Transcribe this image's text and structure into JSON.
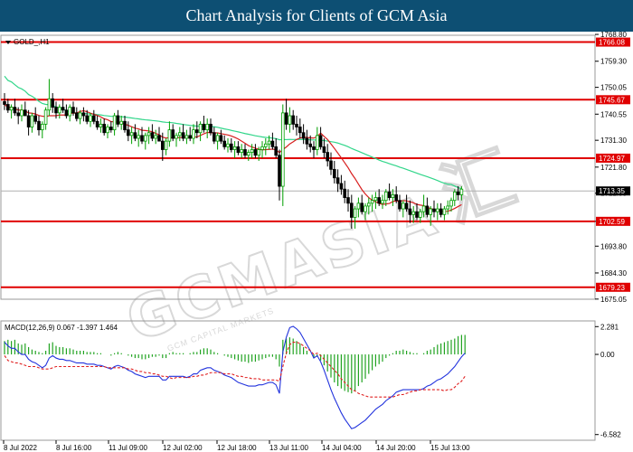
{
  "header": {
    "title": "Chart Analysis for Clients of GCM Asia"
  },
  "watermark": {
    "text": "GCMASIA",
    "chinese": "汇",
    "sub": "GCM CAPITAL MARKETS"
  },
  "chart_data": {
    "type": "candlestick",
    "symbol": "GOLD_,H1",
    "ylim": [
      1675.0,
      1768.5
    ],
    "y_ticks": [
      1768.8,
      1759.3,
      1750.05,
      1740.55,
      1731.3,
      1721.8,
      1712.55,
      1702.59,
      1693.8,
      1684.3,
      1675.05
    ],
    "x_ticks": [
      "8 Jul 2022",
      "8 Jul 16:00",
      "11 Jul 09:00",
      "12 Jul 02:00",
      "12 Jul 18:00",
      "13 Jul 11:00",
      "14 Jul 04:00",
      "14 Jul 20:00",
      "15 Jul 13:00"
    ],
    "levels": [
      {
        "value": 1766.08,
        "label": "1766.08"
      },
      {
        "value": 1745.67,
        "label": "1745.67"
      },
      {
        "value": 1724.97,
        "label": "1724.97"
      },
      {
        "value": 1702.59,
        "label": "1702.59"
      },
      {
        "value": 1679.23,
        "label": "1679.23"
      }
    ],
    "current_price": {
      "value": 1713.35,
      "label": "1713.35"
    },
    "candles": [
      [
        1745,
        1748,
        1742,
        1744
      ],
      [
        1744,
        1746,
        1741,
        1742
      ],
      [
        1742,
        1744,
        1739,
        1743
      ],
      [
        1743,
        1746,
        1740,
        1741
      ],
      [
        1741,
        1743,
        1737,
        1740
      ],
      [
        1740,
        1744,
        1738,
        1742
      ],
      [
        1742,
        1745,
        1740,
        1740
      ],
      [
        1740,
        1742,
        1733,
        1736
      ],
      [
        1736,
        1741,
        1734,
        1740
      ],
      [
        1740,
        1743,
        1737,
        1738
      ],
      [
        1738,
        1740,
        1733,
        1735
      ],
      [
        1735,
        1738,
        1732,
        1737
      ],
      [
        1737,
        1743,
        1735,
        1742
      ],
      [
        1742,
        1753,
        1740,
        1746
      ],
      [
        1746,
        1748,
        1741,
        1743
      ],
      [
        1743,
        1745,
        1739,
        1741
      ],
      [
        1741,
        1744,
        1739,
        1743
      ],
      [
        1743,
        1746,
        1741,
        1742
      ],
      [
        1742,
        1744,
        1739,
        1740
      ],
      [
        1740,
        1744,
        1738,
        1743
      ],
      [
        1743,
        1745,
        1740,
        1741
      ],
      [
        1741,
        1743,
        1738,
        1739
      ],
      [
        1739,
        1742,
        1737,
        1741
      ],
      [
        1741,
        1743,
        1738,
        1740
      ],
      [
        1740,
        1742,
        1737,
        1738
      ],
      [
        1738,
        1741,
        1736,
        1740
      ],
      [
        1740,
        1742,
        1737,
        1738
      ],
      [
        1738,
        1740,
        1735,
        1736
      ],
      [
        1736,
        1739,
        1734,
        1737
      ],
      [
        1737,
        1739,
        1733,
        1734
      ],
      [
        1734,
        1737,
        1732,
        1736
      ],
      [
        1736,
        1738,
        1734,
        1735
      ],
      [
        1735,
        1741,
        1733,
        1740
      ],
      [
        1740,
        1742,
        1736,
        1737
      ],
      [
        1737,
        1740,
        1735,
        1738
      ],
      [
        1738,
        1740,
        1734,
        1735
      ],
      [
        1735,
        1738,
        1731,
        1733
      ],
      [
        1733,
        1736,
        1730,
        1734
      ],
      [
        1734,
        1737,
        1731,
        1732
      ],
      [
        1732,
        1735,
        1729,
        1733
      ],
      [
        1733,
        1736,
        1730,
        1731
      ],
      [
        1731,
        1734,
        1728,
        1733
      ],
      [
        1733,
        1736,
        1730,
        1734
      ],
      [
        1734,
        1737,
        1731,
        1732
      ],
      [
        1732,
        1735,
        1730,
        1733
      ],
      [
        1733,
        1736,
        1731,
        1731
      ],
      [
        1731,
        1734,
        1724,
        1728
      ],
      [
        1728,
        1732,
        1726,
        1731
      ],
      [
        1731,
        1738,
        1729,
        1735
      ],
      [
        1735,
        1737,
        1731,
        1732
      ],
      [
        1732,
        1734,
        1729,
        1733
      ],
      [
        1733,
        1736,
        1731,
        1734
      ],
      [
        1734,
        1737,
        1731,
        1732
      ],
      [
        1732,
        1735,
        1730,
        1733
      ],
      [
        1733,
        1736,
        1731,
        1732
      ],
      [
        1732,
        1737,
        1730,
        1735
      ],
      [
        1735,
        1738,
        1732,
        1734
      ],
      [
        1734,
        1738,
        1731,
        1737
      ],
      [
        1737,
        1740,
        1734,
        1735
      ],
      [
        1735,
        1739,
        1732,
        1737
      ],
      [
        1737,
        1739,
        1733,
        1734
      ],
      [
        1734,
        1736,
        1730,
        1731
      ],
      [
        1731,
        1734,
        1728,
        1733
      ],
      [
        1733,
        1735,
        1730,
        1731
      ],
      [
        1731,
        1733,
        1728,
        1729
      ],
      [
        1729,
        1732,
        1727,
        1730
      ],
      [
        1730,
        1732,
        1727,
        1728
      ],
      [
        1728,
        1731,
        1725,
        1729
      ],
      [
        1729,
        1731,
        1726,
        1727
      ],
      [
        1727,
        1730,
        1725,
        1728
      ],
      [
        1728,
        1730,
        1725,
        1726
      ],
      [
        1726,
        1728,
        1724,
        1727
      ],
      [
        1727,
        1730,
        1725,
        1728
      ],
      [
        1728,
        1730,
        1725,
        1726
      ],
      [
        1726,
        1729,
        1724,
        1728
      ],
      [
        1728,
        1731,
        1725,
        1729
      ],
      [
        1729,
        1732,
        1726,
        1730
      ],
      [
        1730,
        1733,
        1728,
        1731
      ],
      [
        1731,
        1734,
        1728,
        1729
      ],
      [
        1729,
        1732,
        1725,
        1726
      ],
      [
        1726,
        1728,
        1710,
        1715
      ],
      [
        1715,
        1744,
        1708,
        1741
      ],
      [
        1741,
        1746,
        1735,
        1737
      ],
      [
        1737,
        1743,
        1734,
        1740
      ],
      [
        1740,
        1742,
        1735,
        1737
      ],
      [
        1737,
        1740,
        1733,
        1736
      ],
      [
        1736,
        1739,
        1732,
        1734
      ],
      [
        1734,
        1737,
        1730,
        1732
      ],
      [
        1732,
        1735,
        1728,
        1730
      ],
      [
        1730,
        1733,
        1727,
        1729
      ],
      [
        1729,
        1731,
        1725,
        1728
      ],
      [
        1728,
        1736,
        1726,
        1733
      ],
      [
        1733,
        1736,
        1728,
        1729
      ],
      [
        1729,
        1732,
        1725,
        1727
      ],
      [
        1727,
        1730,
        1722,
        1724
      ],
      [
        1724,
        1727,
        1719,
        1721
      ],
      [
        1721,
        1724,
        1716,
        1718
      ],
      [
        1718,
        1721,
        1713,
        1716
      ],
      [
        1716,
        1719,
        1712,
        1714
      ],
      [
        1714,
        1717,
        1709,
        1711
      ],
      [
        1711,
        1714,
        1706,
        1709
      ],
      [
        1709,
        1712,
        1700,
        1704
      ],
      [
        1704,
        1708,
        1700,
        1707
      ],
      [
        1707,
        1711,
        1704,
        1709
      ],
      [
        1709,
        1712,
        1705,
        1706
      ],
      [
        1706,
        1709,
        1703,
        1708
      ],
      [
        1708,
        1711,
        1705,
        1709
      ],
      [
        1709,
        1712,
        1706,
        1710
      ],
      [
        1710,
        1713,
        1707,
        1711
      ],
      [
        1711,
        1714,
        1708,
        1709
      ],
      [
        1709,
        1712,
        1707,
        1710
      ],
      [
        1710,
        1714,
        1708,
        1713
      ],
      [
        1713,
        1716,
        1710,
        1711
      ],
      [
        1711,
        1714,
        1708,
        1712
      ],
      [
        1712,
        1715,
        1709,
        1710
      ],
      [
        1710,
        1712,
        1706,
        1707
      ],
      [
        1707,
        1710,
        1704,
        1709
      ],
      [
        1709,
        1712,
        1706,
        1707
      ],
      [
        1707,
        1710,
        1702,
        1705
      ],
      [
        1705,
        1708,
        1702,
        1706
      ],
      [
        1706,
        1709,
        1703,
        1704
      ],
      [
        1704,
        1707,
        1702,
        1706
      ],
      [
        1706,
        1712,
        1704,
        1708
      ],
      [
        1708,
        1711,
        1704,
        1705
      ],
      [
        1705,
        1708,
        1701,
        1707
      ],
      [
        1707,
        1710,
        1704,
        1706
      ],
      [
        1706,
        1709,
        1703,
        1707
      ],
      [
        1707,
        1709,
        1704,
        1705
      ],
      [
        1705,
        1708,
        1703,
        1707
      ],
      [
        1707,
        1710,
        1705,
        1708
      ],
      [
        1708,
        1711,
        1706,
        1710
      ],
      [
        1710,
        1714,
        1708,
        1713
      ],
      [
        1713,
        1715,
        1710,
        1712
      ],
      [
        1712,
        1715,
        1710,
        1714
      ]
    ],
    "macd": {
      "label": "MACD(12,26,9) 0.067 -1.397 1.464",
      "ylim": [
        -6.9,
        2.6
      ],
      "y_ticks": [
        2.281,
        0.0,
        -6.582
      ],
      "hist": [
        1.1,
        1.2,
        1.1,
        1.2,
        0.9,
        0.8,
        0.9,
        0.6,
        0.4,
        0.3,
        0.2,
        0.1,
        0.3,
        0.9,
        1.0,
        0.7,
        0.6,
        0.6,
        0.5,
        0.5,
        0.4,
        0.3,
        0.3,
        0.3,
        0.2,
        0.2,
        0.2,
        0.1,
        0.1,
        0.0,
        0.0,
        -0.1,
        0.1,
        0.2,
        0.1,
        0.0,
        -0.1,
        -0.2,
        -0.3,
        -0.3,
        -0.4,
        -0.4,
        -0.3,
        -0.2,
        -0.2,
        -0.1,
        -0.3,
        -0.3,
        0.1,
        0.2,
        0.1,
        0.1,
        0.1,
        0.0,
        0.1,
        0.2,
        0.2,
        0.4,
        0.5,
        0.5,
        0.4,
        0.2,
        0.1,
        0.0,
        -0.1,
        -0.2,
        -0.3,
        -0.4,
        -0.5,
        -0.6,
        -0.6,
        -0.7,
        -0.6,
        -0.6,
        -0.5,
        -0.4,
        -0.3,
        -0.2,
        -0.2,
        -0.4,
        -1.0,
        1.2,
        1.3,
        1.4,
        1.3,
        1.1,
        0.9,
        0.6,
        0.3,
        0.0,
        -0.3,
        -0.2,
        -0.5,
        -0.9,
        -1.4,
        -1.9,
        -2.3,
        -2.6,
        -2.8,
        -3.0,
        -3.1,
        -3.2,
        -3.0,
        -2.6,
        -2.3,
        -2.0,
        -1.6,
        -1.3,
        -1.0,
        -0.8,
        -0.6,
        -0.3,
        -0.1,
        0.1,
        0.3,
        0.3,
        0.4,
        0.3,
        0.2,
        0.1,
        0.1,
        0.0,
        0.1,
        0.3,
        0.4,
        0.6,
        0.8,
        0.9,
        1.0,
        1.1,
        1.2,
        1.3,
        1.5,
        1.6,
        1.6
      ],
      "macd": [
        1.0,
        0.7,
        0.5,
        0.5,
        0.2,
        0.0,
        0.0,
        -0.4,
        -0.6,
        -0.7,
        -0.9,
        -1.1,
        -0.9,
        -0.3,
        -0.1,
        -0.3,
        -0.4,
        -0.4,
        -0.5,
        -0.5,
        -0.6,
        -0.7,
        -0.7,
        -0.7,
        -0.8,
        -0.8,
        -0.8,
        -0.9,
        -0.9,
        -1.0,
        -1.1,
        -1.2,
        -1.0,
        -0.9,
        -1.0,
        -1.1,
        -1.3,
        -1.4,
        -1.6,
        -1.7,
        -1.8,
        -1.9,
        -1.8,
        -1.8,
        -1.8,
        -1.8,
        -2.1,
        -2.1,
        -1.8,
        -1.8,
        -1.8,
        -1.8,
        -1.8,
        -1.9,
        -1.8,
        -1.6,
        -1.6,
        -1.3,
        -1.2,
        -1.1,
        -1.1,
        -1.3,
        -1.4,
        -1.5,
        -1.7,
        -1.8,
        -1.9,
        -2.1,
        -2.3,
        -2.4,
        -2.5,
        -2.6,
        -2.6,
        -2.6,
        -2.5,
        -2.5,
        -2.4,
        -2.3,
        -2.3,
        -2.5,
        -3.2,
        0.2,
        1.4,
        2.2,
        2.3,
        2.1,
        1.8,
        1.3,
        0.8,
        0.3,
        -0.3,
        -0.1,
        -0.6,
        -1.3,
        -2.1,
        -2.9,
        -3.6,
        -4.2,
        -4.8,
        -5.3,
        -5.7,
        -6.1,
        -6.0,
        -5.8,
        -5.6,
        -5.4,
        -5.1,
        -4.8,
        -4.5,
        -4.3,
        -4.1,
        -3.8,
        -3.6,
        -3.4,
        -3.1,
        -3.0,
        -2.9,
        -2.9,
        -2.9,
        -2.9,
        -2.9,
        -2.9,
        -2.8,
        -2.6,
        -2.5,
        -2.3,
        -2.1,
        -2.0,
        -1.8,
        -1.6,
        -1.3,
        -1.0,
        -0.6,
        -0.2,
        0.1
      ],
      "signal": [
        -0.1,
        -0.5,
        -0.6,
        -0.7,
        -0.7,
        -0.8,
        -0.9,
        -1.0,
        -1.0,
        -1.0,
        -1.1,
        -1.2,
        -1.2,
        -1.2,
        -1.1,
        -1.0,
        -1.0,
        -1.0,
        -1.0,
        -1.0,
        -1.0,
        -1.0,
        -1.0,
        -1.0,
        -1.0,
        -1.0,
        -1.0,
        -1.0,
        -1.0,
        -1.0,
        -1.1,
        -1.1,
        -1.1,
        -1.1,
        -1.1,
        -1.1,
        -1.2,
        -1.2,
        -1.3,
        -1.4,
        -1.4,
        -1.5,
        -1.5,
        -1.6,
        -1.6,
        -1.7,
        -1.8,
        -1.8,
        -1.9,
        -2.0,
        -1.9,
        -1.9,
        -1.9,
        -1.9,
        -1.9,
        -1.8,
        -1.8,
        -1.7,
        -1.7,
        -1.6,
        -1.5,
        -1.5,
        -1.5,
        -1.5,
        -1.6,
        -1.6,
        -1.6,
        -1.7,
        -1.8,
        -1.8,
        -1.9,
        -1.9,
        -2.0,
        -2.0,
        -2.0,
        -2.1,
        -2.1,
        -2.1,
        -2.1,
        -2.1,
        -2.2,
        -1.0,
        0.1,
        0.8,
        1.0,
        1.0,
        0.9,
        0.7,
        0.5,
        0.3,
        0.0,
        0.1,
        -0.1,
        -0.4,
        -0.7,
        -1.0,
        -1.3,
        -1.6,
        -2.0,
        -2.3,
        -2.6,
        -2.9,
        -3.0,
        -3.2,
        -3.3,
        -3.4,
        -3.5,
        -3.5,
        -3.5,
        -3.5,
        -3.5,
        -3.5,
        -3.5,
        -3.5,
        -3.4,
        -3.3,
        -3.3,
        -3.2,
        -3.1,
        -3.0,
        -3.0,
        -2.9,
        -2.9,
        -2.9,
        -2.9,
        -2.9,
        -2.9,
        -2.9,
        -3.0,
        -2.9,
        -2.9,
        -2.7,
        -2.4,
        -2.2,
        -1.8
      ]
    }
  },
  "colors": {
    "header_bg": "#0d4f73",
    "level_line": "#e00000",
    "bull_candle": "#00a000",
    "bear_candle": "#000000",
    "ma_fast": "#d81f1f",
    "ma_slow": "#31d68a",
    "macd_hist": "#22a422",
    "macd_line": "#2233dd",
    "signal_line": "#e02020"
  }
}
